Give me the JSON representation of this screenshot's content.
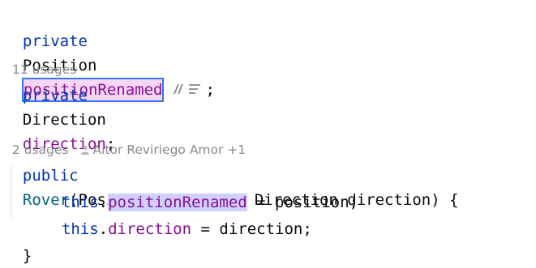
{
  "code": {
    "line1": {
      "modifier": "private",
      "type": "Position",
      "field": "positionRenamed",
      "end": ";"
    },
    "usages1": "11 usages",
    "line2": {
      "modifier": "private",
      "type": "Direction",
      "field": "direction",
      "end": ";"
    },
    "usages2": "2 usages",
    "author": "Aitor Reviriego Amor +1",
    "line3": {
      "modifier": "public",
      "method": "Rover",
      "params": "(Position position, Direction direction) {"
    },
    "line4": {
      "this": "this",
      "dot": ".",
      "field": "positionRenamed",
      "rest": " = position;"
    },
    "line5": {
      "this": "this",
      "dot": ".",
      "field": "direction",
      "rest": " = direction;"
    },
    "line6": "}"
  },
  "icons": {
    "inlay_comment": "comment-icon",
    "inlay_menu": "menu-lines-icon",
    "author": "person-icon"
  },
  "colors": {
    "keyword": "#0033b3",
    "field": "#871094",
    "method": "#00627a",
    "rename_bg": "#f7d7f5",
    "rename_border": "#3574f0",
    "usage_highlight": "#cfd0ff",
    "hint_text": "#8a8a8a"
  }
}
